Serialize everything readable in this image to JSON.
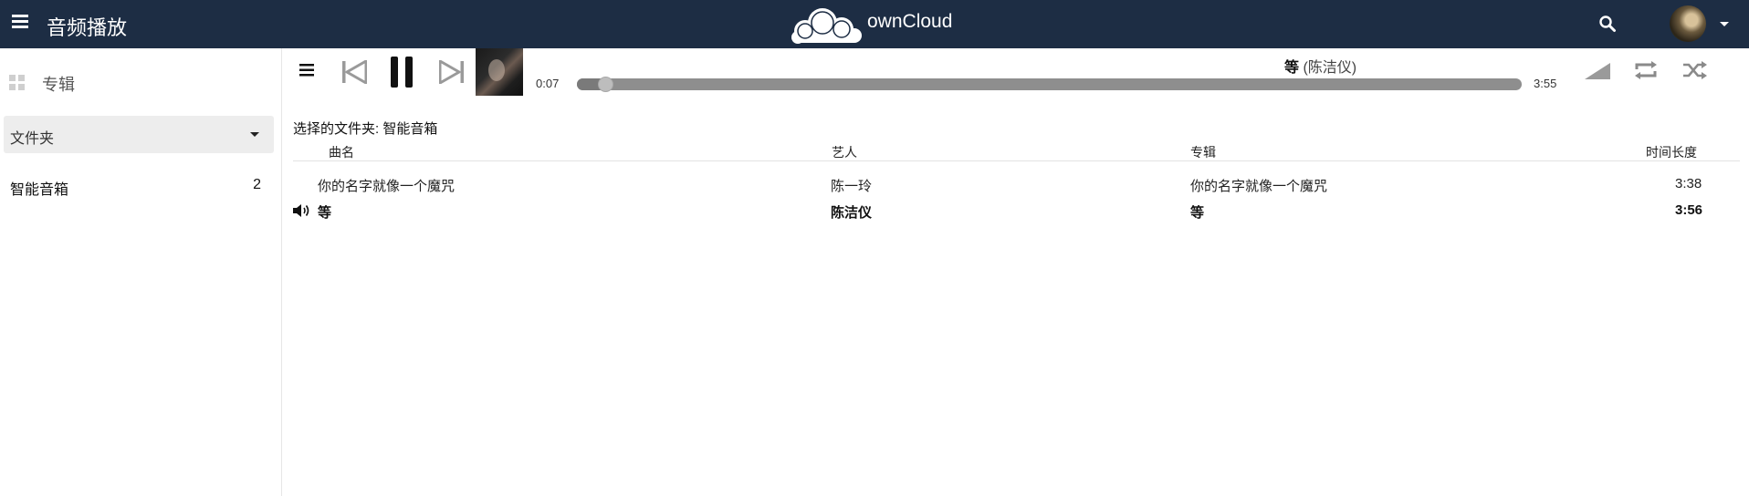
{
  "header": {
    "app_title": "音频播放",
    "brand": "ownCloud",
    "colors": {
      "bar": "#1d2d44",
      "text": "#ffffff"
    }
  },
  "sidebar": {
    "albums_label": "专辑",
    "folder_select": {
      "selected": "文件夹"
    },
    "folders": [
      {
        "name": "智能音箱",
        "count": "2"
      }
    ]
  },
  "player": {
    "time_current": "0:07",
    "time_total": "3:55",
    "progress": 0.03,
    "now_playing": {
      "title": "等",
      "artist": "(陈洁仪)"
    },
    "icons": [
      "playlist-icon",
      "previous-icon",
      "pause-icon",
      "next-icon",
      "volume-icon",
      "repeat-icon",
      "shuffle-icon"
    ]
  },
  "main": {
    "heading": "选择的文件夹: 智能音箱",
    "columns": {
      "title": "曲名",
      "artist": "艺人",
      "album": "专辑",
      "duration": "时间长度"
    },
    "tracks": [
      {
        "title": "你的名字就像一个魔咒",
        "artist": "陈一玲",
        "album": "你的名字就像一个魔咒",
        "duration": "3:38",
        "playing": false
      },
      {
        "title": "等",
        "artist": "陈洁仪",
        "album": "等",
        "duration": "3:56",
        "playing": true
      }
    ]
  }
}
